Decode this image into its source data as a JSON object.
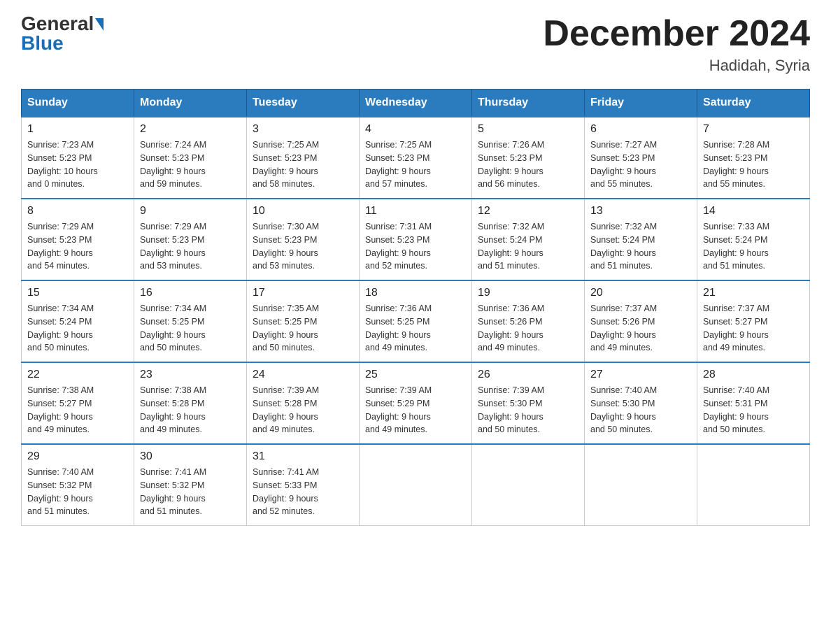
{
  "logo": {
    "general": "General",
    "blue": "Blue",
    "arrow": "▶"
  },
  "title": "December 2024",
  "location": "Hadidah, Syria",
  "weekdays": [
    "Sunday",
    "Monday",
    "Tuesday",
    "Wednesday",
    "Thursday",
    "Friday",
    "Saturday"
  ],
  "weeks": [
    [
      {
        "day": "1",
        "sunrise": "7:23 AM",
        "sunset": "5:23 PM",
        "daylight": "10 hours",
        "minutes": "and 0 minutes."
      },
      {
        "day": "2",
        "sunrise": "7:24 AM",
        "sunset": "5:23 PM",
        "daylight": "9 hours",
        "minutes": "and 59 minutes."
      },
      {
        "day": "3",
        "sunrise": "7:25 AM",
        "sunset": "5:23 PM",
        "daylight": "9 hours",
        "minutes": "and 58 minutes."
      },
      {
        "day": "4",
        "sunrise": "7:25 AM",
        "sunset": "5:23 PM",
        "daylight": "9 hours",
        "minutes": "and 57 minutes."
      },
      {
        "day": "5",
        "sunrise": "7:26 AM",
        "sunset": "5:23 PM",
        "daylight": "9 hours",
        "minutes": "and 56 minutes."
      },
      {
        "day": "6",
        "sunrise": "7:27 AM",
        "sunset": "5:23 PM",
        "daylight": "9 hours",
        "minutes": "and 55 minutes."
      },
      {
        "day": "7",
        "sunrise": "7:28 AM",
        "sunset": "5:23 PM",
        "daylight": "9 hours",
        "minutes": "and 55 minutes."
      }
    ],
    [
      {
        "day": "8",
        "sunrise": "7:29 AM",
        "sunset": "5:23 PM",
        "daylight": "9 hours",
        "minutes": "and 54 minutes."
      },
      {
        "day": "9",
        "sunrise": "7:29 AM",
        "sunset": "5:23 PM",
        "daylight": "9 hours",
        "minutes": "and 53 minutes."
      },
      {
        "day": "10",
        "sunrise": "7:30 AM",
        "sunset": "5:23 PM",
        "daylight": "9 hours",
        "minutes": "and 53 minutes."
      },
      {
        "day": "11",
        "sunrise": "7:31 AM",
        "sunset": "5:23 PM",
        "daylight": "9 hours",
        "minutes": "and 52 minutes."
      },
      {
        "day": "12",
        "sunrise": "7:32 AM",
        "sunset": "5:24 PM",
        "daylight": "9 hours",
        "minutes": "and 51 minutes."
      },
      {
        "day": "13",
        "sunrise": "7:32 AM",
        "sunset": "5:24 PM",
        "daylight": "9 hours",
        "minutes": "and 51 minutes."
      },
      {
        "day": "14",
        "sunrise": "7:33 AM",
        "sunset": "5:24 PM",
        "daylight": "9 hours",
        "minutes": "and 51 minutes."
      }
    ],
    [
      {
        "day": "15",
        "sunrise": "7:34 AM",
        "sunset": "5:24 PM",
        "daylight": "9 hours",
        "minutes": "and 50 minutes."
      },
      {
        "day": "16",
        "sunrise": "7:34 AM",
        "sunset": "5:25 PM",
        "daylight": "9 hours",
        "minutes": "and 50 minutes."
      },
      {
        "day": "17",
        "sunrise": "7:35 AM",
        "sunset": "5:25 PM",
        "daylight": "9 hours",
        "minutes": "and 50 minutes."
      },
      {
        "day": "18",
        "sunrise": "7:36 AM",
        "sunset": "5:25 PM",
        "daylight": "9 hours",
        "minutes": "and 49 minutes."
      },
      {
        "day": "19",
        "sunrise": "7:36 AM",
        "sunset": "5:26 PM",
        "daylight": "9 hours",
        "minutes": "and 49 minutes."
      },
      {
        "day": "20",
        "sunrise": "7:37 AM",
        "sunset": "5:26 PM",
        "daylight": "9 hours",
        "minutes": "and 49 minutes."
      },
      {
        "day": "21",
        "sunrise": "7:37 AM",
        "sunset": "5:27 PM",
        "daylight": "9 hours",
        "minutes": "and 49 minutes."
      }
    ],
    [
      {
        "day": "22",
        "sunrise": "7:38 AM",
        "sunset": "5:27 PM",
        "daylight": "9 hours",
        "minutes": "and 49 minutes."
      },
      {
        "day": "23",
        "sunrise": "7:38 AM",
        "sunset": "5:28 PM",
        "daylight": "9 hours",
        "minutes": "and 49 minutes."
      },
      {
        "day": "24",
        "sunrise": "7:39 AM",
        "sunset": "5:28 PM",
        "daylight": "9 hours",
        "minutes": "and 49 minutes."
      },
      {
        "day": "25",
        "sunrise": "7:39 AM",
        "sunset": "5:29 PM",
        "daylight": "9 hours",
        "minutes": "and 49 minutes."
      },
      {
        "day": "26",
        "sunrise": "7:39 AM",
        "sunset": "5:30 PM",
        "daylight": "9 hours",
        "minutes": "and 50 minutes."
      },
      {
        "day": "27",
        "sunrise": "7:40 AM",
        "sunset": "5:30 PM",
        "daylight": "9 hours",
        "minutes": "and 50 minutes."
      },
      {
        "day": "28",
        "sunrise": "7:40 AM",
        "sunset": "5:31 PM",
        "daylight": "9 hours",
        "minutes": "and 50 minutes."
      }
    ],
    [
      {
        "day": "29",
        "sunrise": "7:40 AM",
        "sunset": "5:32 PM",
        "daylight": "9 hours",
        "minutes": "and 51 minutes."
      },
      {
        "day": "30",
        "sunrise": "7:41 AM",
        "sunset": "5:32 PM",
        "daylight": "9 hours",
        "minutes": "and 51 minutes."
      },
      {
        "day": "31",
        "sunrise": "7:41 AM",
        "sunset": "5:33 PM",
        "daylight": "9 hours",
        "minutes": "and 52 minutes."
      },
      null,
      null,
      null,
      null
    ]
  ]
}
